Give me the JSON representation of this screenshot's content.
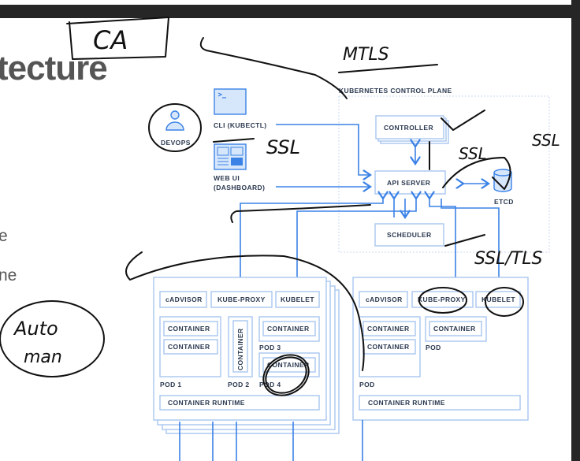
{
  "slide": {
    "title_fragment": "tecture",
    "line1_fragment": "e",
    "line2_fragment": "ne"
  },
  "diagram": {
    "devops": "DEVOPS",
    "cli": "CLI (KUBECTL)",
    "web_ui_line1": "WEB UI",
    "web_ui_line2": "(DASHBOARD)",
    "control_plane": "KUBERNETES CONTROL PLANE",
    "controller": "CONTROLLER",
    "api_server": "API SERVER",
    "etcd": "ETCD",
    "scheduler": "SCHEDULER",
    "node_left": {
      "cadvisor": "cADVISOR",
      "kube_proxy": "KUBE-PROXY",
      "kubelet": "KUBELET",
      "container": "CONTAINER",
      "pod1": "POD 1",
      "pod2": "POD 2",
      "pod3": "POD 3",
      "pod4": "POD 4",
      "runtime": "CONTAINER RUNTIME"
    },
    "node_right": {
      "cadvisor": "cADVISOR",
      "kube_proxy": "KUBE-PROXY",
      "kubelet": "KUBELET",
      "container": "CONTAINER",
      "pod": "POD",
      "runtime": "CONTAINER RUNTIME"
    }
  },
  "annotations": {
    "ca": "CA",
    "mtls": "MTLS",
    "ssl1": "SSL",
    "ssl2": "SSL",
    "ssl3": "SSL",
    "ssl_tls": "SSL/TLS",
    "auto1": "Auto",
    "auto2": "man"
  },
  "colors": {
    "accent": "#3b82e6",
    "box_border": "#a9c6f0",
    "label": "#2b3950",
    "ink": "#111111"
  }
}
